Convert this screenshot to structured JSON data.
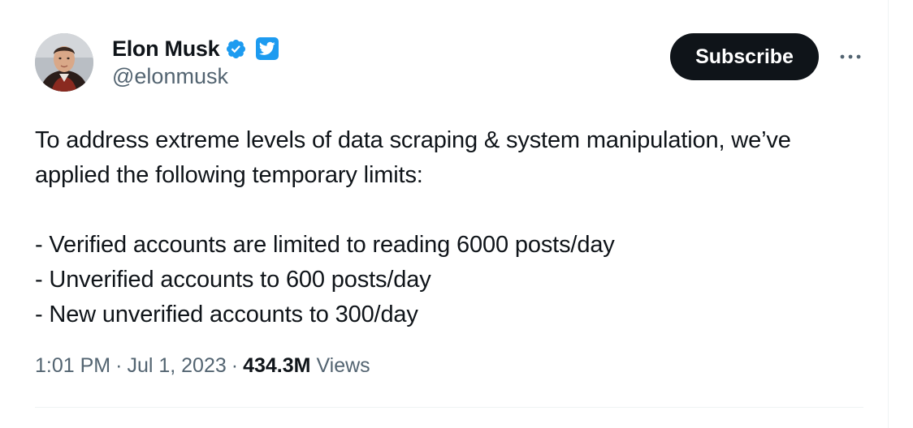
{
  "author": {
    "display_name": "Elon Musk",
    "handle": "@elonmusk",
    "avatar_icon": "profile-photo",
    "verified_icon": "verified-badge-icon",
    "affiliate_icon": "twitter-bird-icon"
  },
  "actions": {
    "subscribe_label": "Subscribe",
    "more_icon": "more-options-icon"
  },
  "tweet": {
    "lines": [
      "To address extreme levels of data scraping & system manipulation, we’ve",
      "applied the following temporary limits:",
      "",
      "- Verified accounts are limited to reading 6000 posts/day",
      "- Unverified accounts to 600 posts/day",
      "- New unverified accounts to 300/day"
    ]
  },
  "meta": {
    "time": "1:01 PM",
    "separator": "·",
    "date": "Jul 1, 2023",
    "views_count": "434.3M",
    "views_label": "Views"
  },
  "colors": {
    "text_primary": "#0f1419",
    "text_secondary": "#536471",
    "accent_blue": "#1d9bf0",
    "divider": "#eff3f4"
  }
}
